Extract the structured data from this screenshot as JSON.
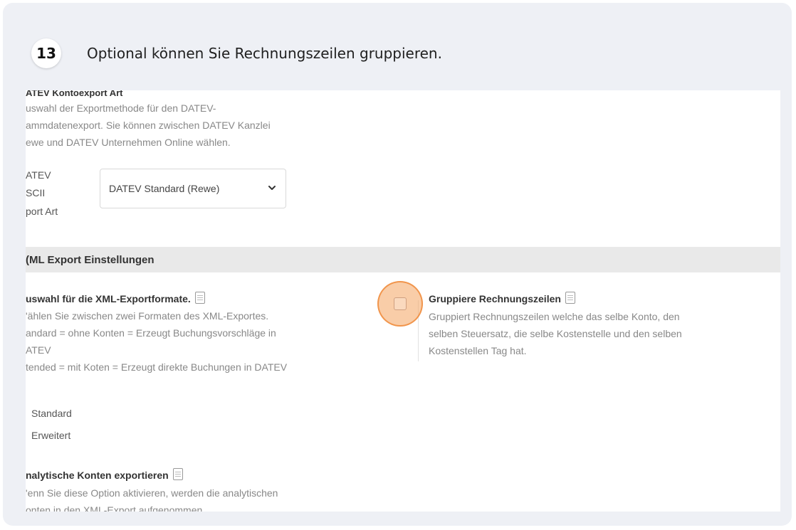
{
  "step": {
    "number": "13",
    "text": "Optional können Sie Rechnungszeilen gruppieren."
  },
  "datev": {
    "title": "ATEV Kontoexport Art",
    "desc_lines": [
      "uswahl der Exportmethode für den DATEV-",
      "ammdatenexport. Sie können zwischen DATEV Kanzlei",
      "ewe und DATEV Unternehmen Online wählen."
    ],
    "field_label_lines": [
      "ATEV",
      "SCII",
      "port Art"
    ],
    "select_value": "DATEV Standard (Rewe)"
  },
  "section_title": "(ML Export Einstellungen",
  "xml_formats": {
    "title": "uswahl für die XML-Exportformate.",
    "desc_lines": [
      "'ählen Sie zwischen zwei Formaten des XML-Exportes.",
      "andard = ohne Konten = Erzeugt Buchungsvorschläge in",
      "ATEV",
      "tended = mit Koten = Erzeugt direkte Buchungen in DATEV"
    ],
    "options": [
      "Standard",
      "Erweitert"
    ]
  },
  "group_lines": {
    "title": "Gruppiere Rechnungszeilen",
    "desc_lines": [
      "Gruppiert Rechnungszeilen welche das selbe Konto, den",
      "selben Steuersatz, die selbe Kostenstelle und den selben",
      "Kostenstellen Tag hat."
    ]
  },
  "analytic": {
    "title": "nalytische Konten exportieren",
    "desc_lines": [
      "'enn Sie diese Option aktivieren, werden die analytischen",
      "onten in den XML-Export aufgenommen"
    ]
  },
  "colors": {
    "card_bg": "#eef0f5",
    "highlight": "#f4a460",
    "section_bg": "#e9e9e9"
  }
}
